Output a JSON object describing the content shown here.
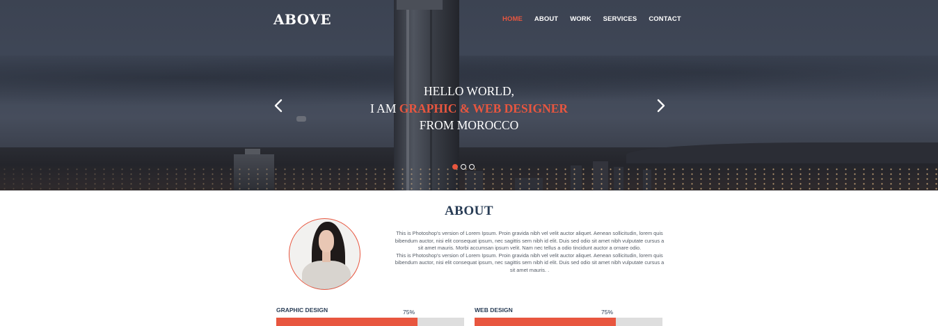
{
  "header": {
    "logo": "ABOVE",
    "nav": [
      {
        "label": "HOME",
        "active": true
      },
      {
        "label": "ABOUT",
        "active": false
      },
      {
        "label": "WORK",
        "active": false
      },
      {
        "label": "SERVICES",
        "active": false
      },
      {
        "label": "CONTACT",
        "active": false
      }
    ]
  },
  "hero": {
    "line1": "HELLO WORLD,",
    "line2_prefix": "I AM ",
    "line2_accent": "GRAPHIC & WEB DESIGNER",
    "line3": "FROM MOROCCO",
    "slides": 3,
    "active_slide": 1,
    "prev_icon": "chevron-left-icon",
    "next_icon": "chevron-right-icon"
  },
  "about": {
    "title": "ABOUT",
    "paragraph1": "This is Photoshop's version of Lorem Ipsum. Proin gravida nibh vel velit auctor aliquet. Aenean sollicitudin, lorem quis bibendum auctor, nisi elit consequat ipsum, nec sagittis sem nibh id elit. Duis sed odio sit amet nibh vulputate cursus a sit amet mauris. Morbi accumsan ipsum velit. Nam nec tellus a odio tincidunt auctor a ornare odio.",
    "paragraph2": "This is Photoshop's version of Lorem Ipsum. Proin gravida nibh vel velit auctor aliquet. Aenean sollicitudin, lorem quis bibendum auctor, nisi elit consequat ipsum, nec sagittis sem nibh id elit. Duis sed odio sit amet nibh vulputate cursus a sit amet mauris. ."
  },
  "skills": [
    {
      "name": "GRAPHIC DESIGN",
      "percent_label": "75%",
      "value": 0.75
    },
    {
      "name": "WEB DESIGN",
      "percent_label": "75%",
      "value": 0.75
    }
  ],
  "colors": {
    "accent": "#e8563f",
    "heading": "#283c55",
    "track": "#dedede"
  }
}
